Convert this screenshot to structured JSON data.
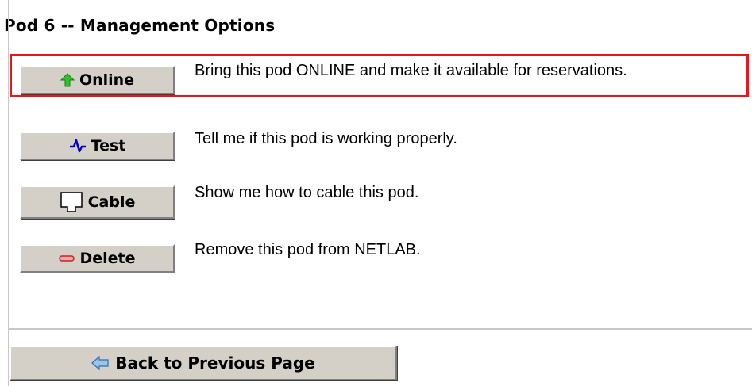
{
  "page": {
    "title": "Pod 6 -- Management Options"
  },
  "options": [
    {
      "button_label": "Online",
      "icon": "green-up-arrow-icon",
      "description": "Bring this pod ONLINE and make it available for reservations.",
      "highlighted": true
    },
    {
      "button_label": "Test",
      "icon": "pulse-wave-icon",
      "description": "Tell me if this pod is working properly."
    },
    {
      "button_label": "Cable",
      "icon": "cable-port-icon",
      "description": "Show me how to cable this pod."
    },
    {
      "button_label": "Delete",
      "icon": "minus-bar-icon",
      "description": "Remove this pod from NETLAB."
    }
  ],
  "footer": {
    "back_label": "Back to Previous Page",
    "back_icon": "blue-left-arrow-icon"
  },
  "colors": {
    "highlight_border": "#e8161b",
    "button_face": "#d4d0c8",
    "online_icon": "#2fbf2f",
    "test_icon": "#0000cc",
    "delete_icon": "#c0272d",
    "back_icon": "#6fa8dc"
  }
}
